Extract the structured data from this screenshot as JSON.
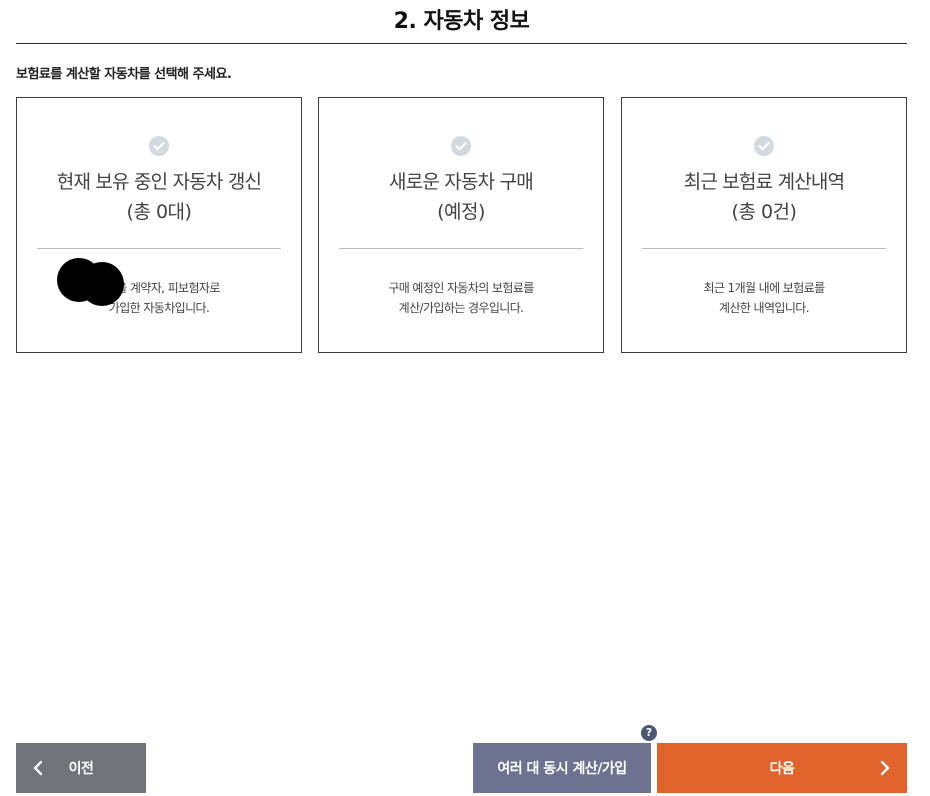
{
  "page": {
    "title": "2. 자동차 정보",
    "instruction": "보험료를 계산할 자동차를 선택해 주세요."
  },
  "cards": [
    {
      "title": "현재 보유 중인 자동차 갱신",
      "count": "(총 0대)",
      "desc_line1": "을 계약자, 피보험자로",
      "desc_line2": "가입한 자동차입니다."
    },
    {
      "title": "새로운 자동차 구매",
      "count": "(예정)",
      "desc_line1": "구매 예정인 자동차의 보험료를",
      "desc_line2": "계산/가입하는 경우입니다."
    },
    {
      "title": "최근 보험료 계산내역",
      "count": "(총 0건)",
      "desc_line1": "최근 1개월 내에 보험료를",
      "desc_line2": "계산한 내역입니다."
    }
  ],
  "buttons": {
    "prev_label": "이전",
    "multi_label": "여러 대 동시 계산/가입",
    "next_label": "다음",
    "help_glyph": "?"
  },
  "colors": {
    "accent": "#e0632b",
    "prev_bg": "#6f747b",
    "multi_bg": "#6d7290",
    "check_icon": "#d4d9e0",
    "help_icon": "#4a5775"
  },
  "icons": [
    "check-circle-icon",
    "chevron-left-icon",
    "chevron-right-icon",
    "help-icon"
  ]
}
